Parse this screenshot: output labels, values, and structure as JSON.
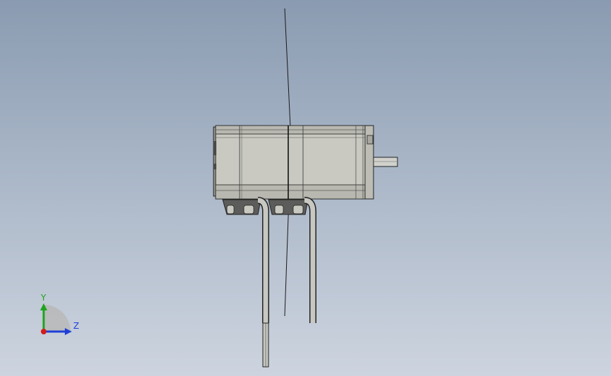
{
  "viewport": {
    "background_top": "#8a9bb1",
    "background_bottom": "#cdd4df"
  },
  "model": {
    "name": "stepper-motor-assembly",
    "body_color": "#c9c9c1",
    "edge_color": "#222222",
    "shaft_color": "#d0d0cc"
  },
  "triad": {
    "y_label": "Y",
    "z_label": "Z",
    "y_color": "#1ea41e",
    "z_color": "#1f3fd6",
    "x_color": "#d21c1c"
  }
}
